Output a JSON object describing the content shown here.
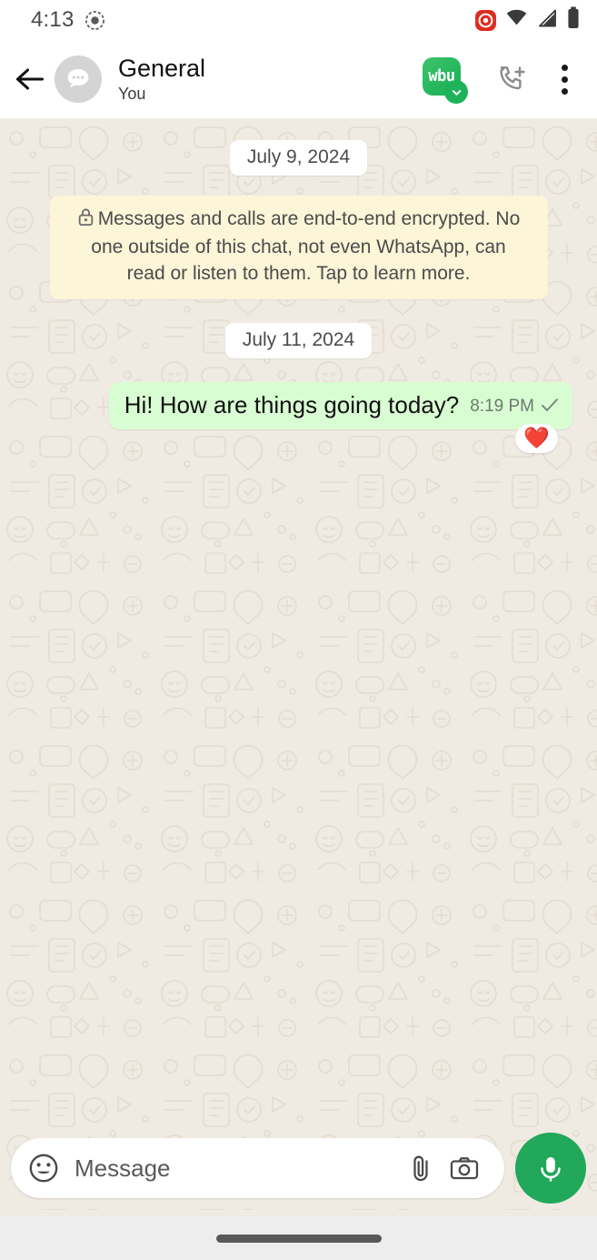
{
  "statusbar": {
    "time": "4:13",
    "icons": [
      "screen-record-icon",
      "wifi-icon",
      "cellular-signal-icon",
      "battery-icon"
    ],
    "recording_color": "#E02B20"
  },
  "header": {
    "back_label": "Back",
    "avatar_icon": "group-chat-bubble-icon",
    "title": "General",
    "subtitle": "You",
    "app_badge_glyph": "wbu",
    "app_badge_color": "#25B65C",
    "call_icon": "add-call-icon",
    "menu_icon": "overflow-menu-icon"
  },
  "chat": {
    "background_color": "#EFEAE2",
    "items": [
      {
        "kind": "date",
        "text": "July 9, 2024"
      },
      {
        "kind": "encryption",
        "text": "Messages and calls are end-to-end encrypted. No one outside of this chat, not even WhatsApp, can read or listen to them. Tap to learn more.",
        "icon": "lock-icon"
      },
      {
        "kind": "date",
        "text": "July 11, 2024"
      },
      {
        "kind": "message",
        "text": "Hi! How are things going today?",
        "time": "8:19 PM",
        "status": "sent",
        "outgoing": true,
        "bubble_color": "#D9FDD3",
        "reaction": "❤️"
      }
    ],
    "date_chip_1": "July 9, 2024",
    "encryption_notice": "Messages and calls are end-to-end encrypted. No one outside of this chat, not even WhatsApp, can read or listen to them. Tap to learn more.",
    "date_chip_2": "July 11, 2024",
    "message_text": "Hi! How are things going today?",
    "message_time": "8:19 PM",
    "message_reaction": "❤️"
  },
  "composer": {
    "placeholder": "Message",
    "emoji_icon": "emoji-smiley-icon",
    "attach_icon": "paperclip-icon",
    "camera_icon": "camera-icon",
    "mic_icon": "microphone-icon",
    "mic_color": "#21A85A"
  },
  "navbar": {
    "gesture_pill": "home-gesture-pill"
  }
}
